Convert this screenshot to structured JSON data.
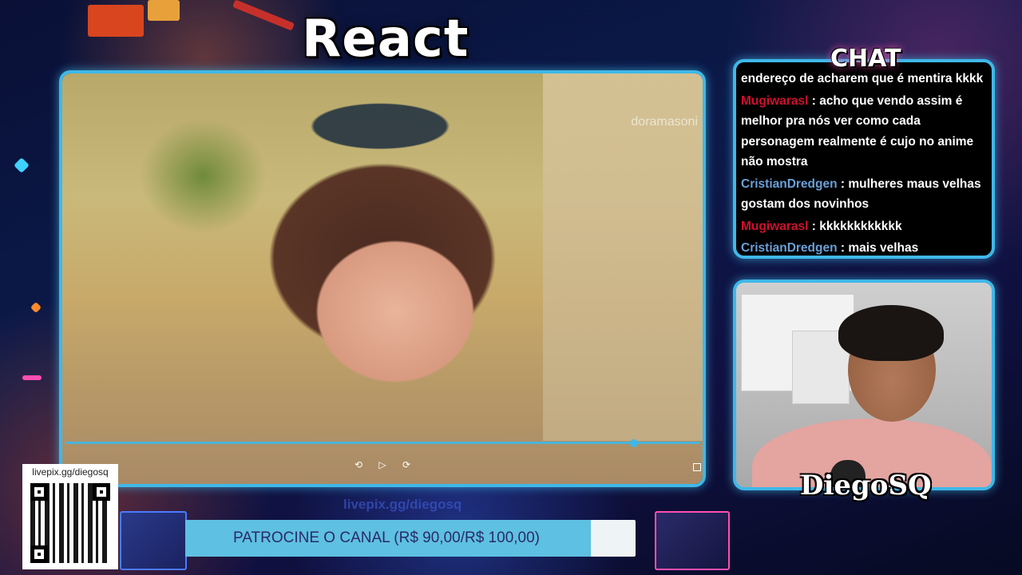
{
  "header": {
    "title": "React"
  },
  "video": {
    "watermark": "doramasoni",
    "progress_fraction": 0.89,
    "controls": {
      "rewind_icon": "rewind-icon",
      "play_icon": "play-icon",
      "forward_icon": "forward-icon",
      "fullscreen_icon": "fullscreen-icon"
    }
  },
  "chat": {
    "title": "CHAT",
    "messages": [
      {
        "user": "",
        "text": "endereço de acharem que é mentira kkkk"
      },
      {
        "user": "Mugiwarasl",
        "text": " : acho que vendo assim é melhor pra nós ver como cada personagem realmente é cujo no anime não mostra"
      },
      {
        "user": "CristianDredgen",
        "text": " : mulheres maus velhas gostam dos novinhos"
      },
      {
        "user": "Mugiwarasl",
        "text": " : kkkkkkkkkkkk"
      },
      {
        "user": "CristianDredgen",
        "text": " : mais velhas"
      }
    ],
    "user_colors": {
      "Mugiwarasl": "#d0102e",
      "CristianDredgen": "#6aa0d8"
    }
  },
  "webcam": {
    "name": "DiegoSQ"
  },
  "qr": {
    "label": "livepix.gg/diegosq"
  },
  "sponsor": {
    "url": "livepix.gg/diegosq",
    "label": "PATROCINE O CANAL (R$ 90,00/R$ 100,00)",
    "progress_fraction": 0.9
  },
  "colors": {
    "accent": "#3fb8e8",
    "sponsor_fill": "#5ec0e2"
  }
}
